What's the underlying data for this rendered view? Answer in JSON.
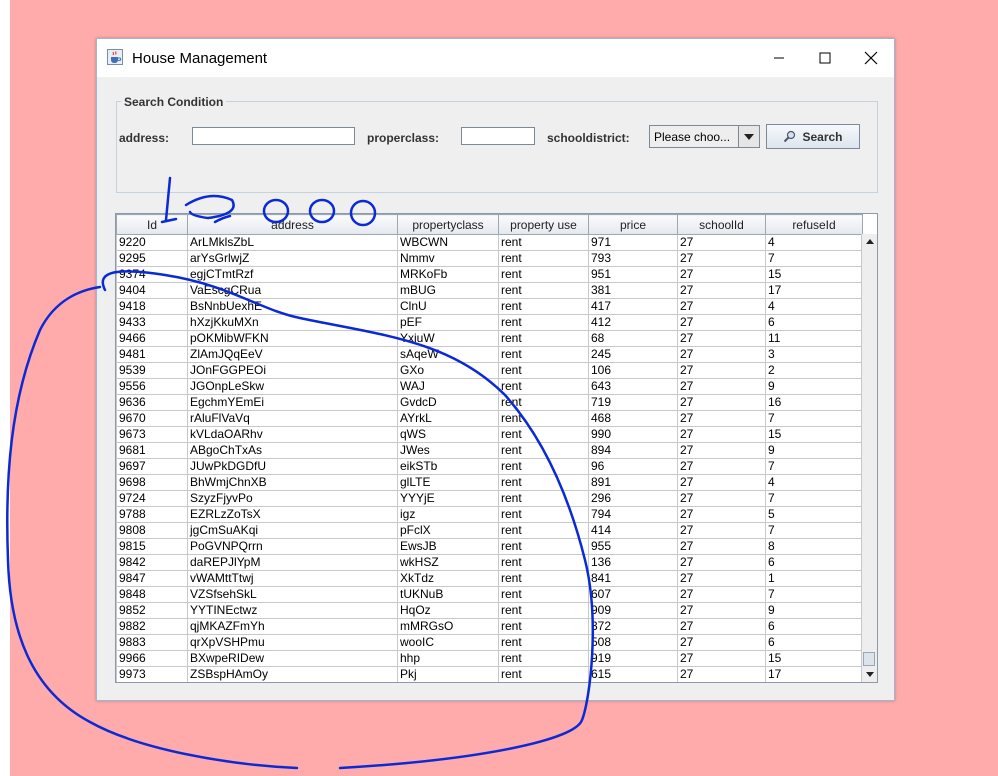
{
  "window": {
    "title": "House Management"
  },
  "search": {
    "group_title": "Search Condition",
    "address_label": "address:",
    "address_value": "",
    "properclass_label": "properclass:",
    "properclass_value": "",
    "schooldistrict_label": "schooldistrict:",
    "schooldistrict_selected": "Please choo...",
    "search_button": "Search"
  },
  "annotation_text": "10,000",
  "table": {
    "columns": [
      "Id",
      "address",
      "propertyclass",
      "property use",
      "price",
      "schoolId",
      "refuseId"
    ],
    "rows": [
      [
        "9220",
        "ArLMklsZbL",
        "WBCWN",
        "rent",
        "971",
        "27",
        "4"
      ],
      [
        "9295",
        "arYsGrlwjZ",
        "Nmmv",
        "rent",
        "793",
        "27",
        "7"
      ],
      [
        "9374",
        "egjCTmtRzf",
        "MRKoFb",
        "rent",
        "951",
        "27",
        "15"
      ],
      [
        "9404",
        "VaEscgCRua",
        "mBUG",
        "rent",
        "381",
        "27",
        "17"
      ],
      [
        "9418",
        "BsNnbUexhE",
        "ClnU",
        "rent",
        "417",
        "27",
        "4"
      ],
      [
        "9433",
        "hXzjKkuMXn",
        "pEF",
        "rent",
        "412",
        "27",
        "6"
      ],
      [
        "9466",
        "pOKMibWFKN",
        "YxiuW",
        "rent",
        "68",
        "27",
        "11"
      ],
      [
        "9481",
        "ZlAmJQqEeV",
        "sAqeW",
        "rent",
        "245",
        "27",
        "3"
      ],
      [
        "9539",
        "JOnFGGPEOi",
        "GXo",
        "rent",
        "106",
        "27",
        "2"
      ],
      [
        "9556",
        "JGOnpLeSkw",
        "WAJ",
        "rent",
        "643",
        "27",
        "9"
      ],
      [
        "9636",
        "EgchmYEmEi",
        "GvdcD",
        "rent",
        "719",
        "27",
        "16"
      ],
      [
        "9670",
        "rAluFlVaVq",
        "AYrkL",
        "rent",
        "468",
        "27",
        "7"
      ],
      [
        "9673",
        "kVLdaOARhv",
        "qWS",
        "rent",
        "990",
        "27",
        "15"
      ],
      [
        "9681",
        "ABgoChTxAs",
        "JWes",
        "rent",
        "894",
        "27",
        "9"
      ],
      [
        "9697",
        "JUwPkDGDfU",
        "eikSTb",
        "rent",
        "96",
        "27",
        "7"
      ],
      [
        "9698",
        "BhWmjChnXB",
        "glLTE",
        "rent",
        "891",
        "27",
        "4"
      ],
      [
        "9724",
        "SzyzFjyvPo",
        "YYYjE",
        "rent",
        "296",
        "27",
        "7"
      ],
      [
        "9788",
        "EZRLzZoTsX",
        "igz",
        "rent",
        "794",
        "27",
        "5"
      ],
      [
        "9808",
        "jgCmSuAKqi",
        "pFclX",
        "rent",
        "414",
        "27",
        "7"
      ],
      [
        "9815",
        "PoGVNPQrrn",
        "EwsJB",
        "rent",
        "955",
        "27",
        "8"
      ],
      [
        "9842",
        "daREPJlYpM",
        "wkHSZ",
        "rent",
        "136",
        "27",
        "6"
      ],
      [
        "9847",
        "vWAMttTtwj",
        "XkTdz",
        "rent",
        "841",
        "27",
        "1"
      ],
      [
        "9848",
        "VZSfsehSkL",
        "tUKNuB",
        "rent",
        "607",
        "27",
        "7"
      ],
      [
        "9852",
        "YYTINEctwz",
        "HqOz",
        "rent",
        "909",
        "27",
        "9"
      ],
      [
        "9882",
        "qjMKAZFmYh",
        "mMRGsO",
        "rent",
        "372",
        "27",
        "6"
      ],
      [
        "9883",
        "qrXpVSHPmu",
        "wooIC",
        "rent",
        "508",
        "27",
        "6"
      ],
      [
        "9966",
        "BXwpeRIDew",
        "hhp",
        "rent",
        "919",
        "27",
        "15"
      ],
      [
        "9973",
        "ZSBspHAmOy",
        "Pkj",
        "rent",
        "615",
        "27",
        "17"
      ]
    ]
  },
  "colors": {
    "background": "#ffabab",
    "ink": "#0a2ad6",
    "window_border": "#9fb7d6"
  },
  "icons": [
    "java-cup-icon",
    "minimize-icon",
    "maximize-icon",
    "close-icon",
    "chevron-down-icon",
    "magnifier-icon",
    "scroll-up-icon",
    "scroll-down-icon"
  ]
}
